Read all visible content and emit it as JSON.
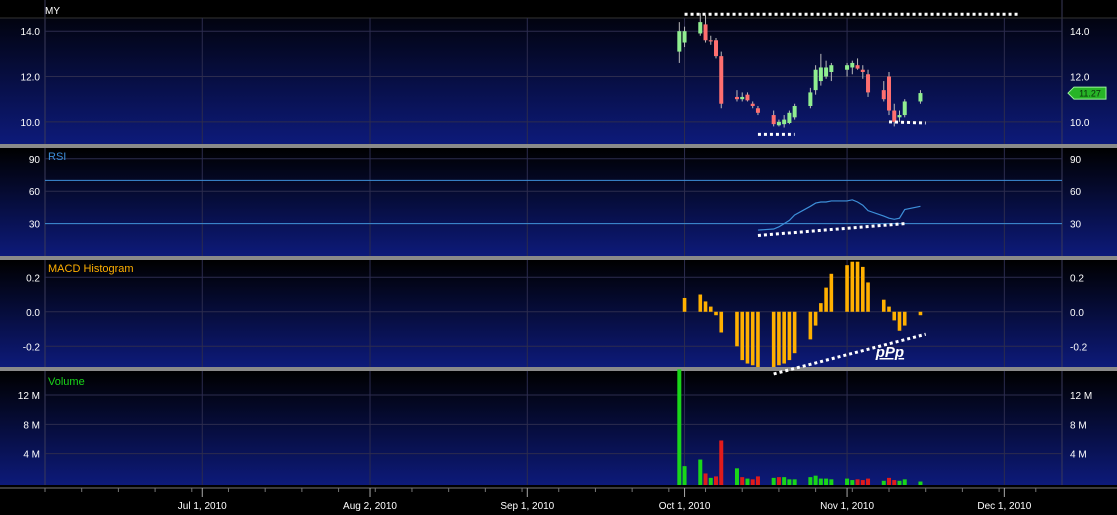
{
  "symbol": "MY",
  "colors": {
    "up": "#90ee90",
    "down": "#ff6f6f",
    "rsi": "#3d8fd9",
    "macd": "#ffb000",
    "volume_up": "#19d619",
    "volume_down": "#e01b1b",
    "separator": "#8a8a8a",
    "annotation": "#ffffff",
    "badge": "#27b427"
  },
  "chart_data": [
    {
      "panel": "price",
      "type": "candlestick",
      "title": "",
      "ylim": [
        9.2,
        15.2
      ],
      "y_ticks": [
        "14.0",
        "12.0",
        "10.0"
      ],
      "y_tick_values": [
        14,
        12,
        10
      ],
      "last_price_label": "11.27",
      "last_price": 11.27,
      "candles": [
        {
          "date": "2010-09-30",
          "o": 13.1,
          "h": 14.4,
          "l": 12.6,
          "c": 14.0
        },
        {
          "date": "2010-10-01",
          "o": 13.5,
          "h": 14.2,
          "l": 13.3,
          "c": 14.0
        },
        {
          "date": "2010-10-04",
          "o": 13.9,
          "h": 14.8,
          "l": 13.8,
          "c": 14.4
        },
        {
          "date": "2010-10-05",
          "o": 14.3,
          "h": 14.7,
          "l": 13.5,
          "c": 13.6
        },
        {
          "date": "2010-10-06",
          "o": 13.6,
          "h": 13.8,
          "l": 13.4,
          "c": 13.55
        },
        {
          "date": "2010-10-07",
          "o": 13.6,
          "h": 13.7,
          "l": 12.8,
          "c": 12.9
        },
        {
          "date": "2010-10-08",
          "o": 12.9,
          "h": 13.1,
          "l": 10.6,
          "c": 10.8
        },
        {
          "date": "2010-10-11",
          "o": 11.1,
          "h": 11.4,
          "l": 10.9,
          "c": 11.0
        },
        {
          "date": "2010-10-12",
          "o": 11.0,
          "h": 11.3,
          "l": 10.9,
          "c": 11.1
        },
        {
          "date": "2010-10-13",
          "o": 11.2,
          "h": 11.3,
          "l": 10.9,
          "c": 10.95
        },
        {
          "date": "2010-10-14",
          "o": 10.8,
          "h": 10.9,
          "l": 10.6,
          "c": 10.7
        },
        {
          "date": "2010-10-15",
          "o": 10.6,
          "h": 10.7,
          "l": 10.3,
          "c": 10.4
        },
        {
          "date": "2010-10-18",
          "o": 10.3,
          "h": 10.5,
          "l": 9.8,
          "c": 9.9
        },
        {
          "date": "2010-10-19",
          "o": 9.85,
          "h": 10.1,
          "l": 9.8,
          "c": 10.0
        },
        {
          "date": "2010-10-20",
          "o": 9.9,
          "h": 10.3,
          "l": 9.75,
          "c": 10.1
        },
        {
          "date": "2010-10-21",
          "o": 9.95,
          "h": 10.5,
          "l": 9.9,
          "c": 10.4
        },
        {
          "date": "2010-10-22",
          "o": 10.2,
          "h": 10.8,
          "l": 10.1,
          "c": 10.7
        },
        {
          "date": "2010-10-25",
          "o": 10.7,
          "h": 11.5,
          "l": 10.6,
          "c": 11.3
        },
        {
          "date": "2010-10-26",
          "o": 11.4,
          "h": 12.5,
          "l": 11.2,
          "c": 12.3
        },
        {
          "date": "2010-10-27",
          "o": 11.8,
          "h": 13.0,
          "l": 11.6,
          "c": 12.4
        },
        {
          "date": "2010-10-28",
          "o": 12.0,
          "h": 12.7,
          "l": 11.9,
          "c": 12.4
        },
        {
          "date": "2010-10-29",
          "o": 12.2,
          "h": 12.6,
          "l": 11.8,
          "c": 12.5
        },
        {
          "date": "2010-11-01",
          "o": 12.3,
          "h": 12.6,
          "l": 12.0,
          "c": 12.5
        },
        {
          "date": "2010-11-02",
          "o": 12.4,
          "h": 12.7,
          "l": 12.1,
          "c": 12.6
        },
        {
          "date": "2010-11-03",
          "o": 12.5,
          "h": 12.8,
          "l": 12.3,
          "c": 12.35
        },
        {
          "date": "2010-11-04",
          "o": 12.3,
          "h": 12.5,
          "l": 11.9,
          "c": 12.2
        },
        {
          "date": "2010-11-05",
          "o": 12.1,
          "h": 12.3,
          "l": 11.1,
          "c": 11.3
        },
        {
          "date": "2010-11-08",
          "o": 11.4,
          "h": 11.8,
          "l": 10.9,
          "c": 11.0
        },
        {
          "date": "2010-11-09",
          "o": 12.0,
          "h": 12.2,
          "l": 10.3,
          "c": 10.5
        },
        {
          "date": "2010-11-10",
          "o": 10.5,
          "h": 10.8,
          "l": 9.8,
          "c": 10.0
        },
        {
          "date": "2010-11-11",
          "o": 10.2,
          "h": 10.5,
          "l": 10.0,
          "c": 10.3
        },
        {
          "date": "2010-11-12",
          "o": 10.3,
          "h": 11.0,
          "l": 10.2,
          "c": 10.9
        },
        {
          "date": "2010-11-15",
          "o": 10.9,
          "h": 11.4,
          "l": 10.8,
          "c": 11.27
        }
      ],
      "trendlines": [
        {
          "x0": "2010-10-01",
          "y0": 14.75,
          "x1": "2010-12-04",
          "y1": 14.75
        },
        {
          "x0": "2010-10-15",
          "y0": 9.45,
          "x1": "2010-10-22",
          "y1": 9.45
        },
        {
          "x0": "2010-11-09",
          "y0": 10.0,
          "x1": "2010-11-16",
          "y1": 9.95
        }
      ]
    },
    {
      "panel": "rsi",
      "type": "line",
      "title": "RSI",
      "ylim": [
        0,
        100
      ],
      "y_ticks": [
        "90",
        "60",
        "30"
      ],
      "y_tick_values": [
        90,
        60,
        30
      ],
      "reference_lines": [
        70,
        30
      ],
      "series": [
        {
          "x": [
            "2010-10-15",
            "2010-10-18",
            "2010-10-19",
            "2010-10-20",
            "2010-10-21",
            "2010-10-22",
            "2010-10-25",
            "2010-10-26",
            "2010-10-27",
            "2010-10-28",
            "2010-10-29",
            "2010-11-01",
            "2010-11-02",
            "2010-11-03",
            "2010-11-04",
            "2010-11-05",
            "2010-11-08",
            "2010-11-09",
            "2010-11-10",
            "2010-11-11",
            "2010-11-12",
            "2010-11-15"
          ],
          "values": [
            24,
            25,
            27,
            30,
            33,
            38,
            46,
            49,
            50,
            50,
            51,
            51,
            52,
            50,
            47,
            42,
            37,
            35,
            34,
            35,
            43,
            46
          ]
        }
      ],
      "trendlines": [
        {
          "x0": "2010-10-15",
          "y0": 19,
          "x1": "2010-11-12",
          "y1": 30
        }
      ]
    },
    {
      "panel": "macd",
      "type": "bar",
      "title": "MACD Histogram",
      "ylim": [
        -0.32,
        0.3
      ],
      "y_ticks": [
        "0.2",
        "0.0",
        "-0.2"
      ],
      "y_tick_values": [
        0.2,
        0.0,
        -0.2
      ],
      "x": [
        "2010-10-01",
        "2010-10-04",
        "2010-10-05",
        "2010-10-06",
        "2010-10-07",
        "2010-10-08",
        "2010-10-11",
        "2010-10-12",
        "2010-10-13",
        "2010-10-14",
        "2010-10-15",
        "2010-10-18",
        "2010-10-19",
        "2010-10-20",
        "2010-10-21",
        "2010-10-22",
        "2010-10-25",
        "2010-10-26",
        "2010-10-27",
        "2010-10-28",
        "2010-10-29",
        "2010-11-01",
        "2010-11-02",
        "2010-11-03",
        "2010-11-04",
        "2010-11-05",
        "2010-11-08",
        "2010-11-09",
        "2010-11-10",
        "2010-11-11",
        "2010-11-12",
        "2010-11-15"
      ],
      "values": [
        0.08,
        0.1,
        0.06,
        0.03,
        -0.02,
        -0.12,
        -0.2,
        -0.28,
        -0.3,
        -0.31,
        -0.32,
        -0.32,
        -0.31,
        -0.3,
        -0.28,
        -0.24,
        -0.16,
        -0.08,
        0.05,
        0.14,
        0.22,
        0.27,
        0.29,
        0.29,
        0.26,
        0.17,
        0.07,
        0.03,
        -0.05,
        -0.11,
        -0.08,
        -0.02
      ],
      "trendlines": [
        {
          "x0": "2010-10-18",
          "y0": -0.36,
          "x1": "2010-11-16",
          "y1": -0.13
        }
      ],
      "annotation": "pPp"
    },
    {
      "panel": "volume",
      "type": "bar",
      "title": "Volume",
      "ylim": [
        0,
        15
      ],
      "y_ticks": [
        "12 M",
        "8 M",
        "4 M"
      ],
      "y_tick_values": [
        12,
        8,
        4
      ],
      "units": "M",
      "x": [
        "2010-09-30",
        "2010-10-01",
        "2010-10-04",
        "2010-10-05",
        "2010-10-06",
        "2010-10-07",
        "2010-10-08",
        "2010-10-11",
        "2010-10-12",
        "2010-10-13",
        "2010-10-14",
        "2010-10-15",
        "2010-10-18",
        "2010-10-19",
        "2010-10-20",
        "2010-10-21",
        "2010-10-22",
        "2010-10-25",
        "2010-10-26",
        "2010-10-27",
        "2010-10-28",
        "2010-10-29",
        "2010-11-01",
        "2010-11-02",
        "2010-11-03",
        "2010-11-04",
        "2010-11-05",
        "2010-11-08",
        "2010-11-09",
        "2010-11-10",
        "2010-11-11",
        "2010-11-12",
        "2010-11-15"
      ],
      "values": [
        15.5,
        2.3,
        3.2,
        1.3,
        0.7,
        0.9,
        5.8,
        2.0,
        0.8,
        0.6,
        0.5,
        0.9,
        0.7,
        0.8,
        0.8,
        0.5,
        0.5,
        0.8,
        1.0,
        0.6,
        0.6,
        0.5,
        0.6,
        0.4,
        0.5,
        0.4,
        0.6,
        0.3,
        0.7,
        0.4,
        0.3,
        0.5,
        0.2
      ],
      "up": [
        true,
        true,
        true,
        false,
        true,
        false,
        false,
        true,
        false,
        true,
        false,
        false,
        true,
        false,
        true,
        true,
        true,
        true,
        true,
        true,
        true,
        true,
        true,
        true,
        false,
        false,
        false,
        true,
        false,
        false,
        true,
        true,
        true
      ]
    }
  ],
  "x_axis": {
    "range": [
      "2010-06-01",
      "2010-12-12"
    ],
    "tick_labels": [
      "Jul 1, 2010",
      "Aug 2, 2010",
      "Sep 1, 2010",
      "Oct 1, 2010",
      "Nov 1, 2010",
      "Dec 1, 2010"
    ],
    "tick_dates": [
      "2010-07-01",
      "2010-08-02",
      "2010-09-01",
      "2010-10-01",
      "2010-11-01",
      "2010-12-01"
    ]
  }
}
